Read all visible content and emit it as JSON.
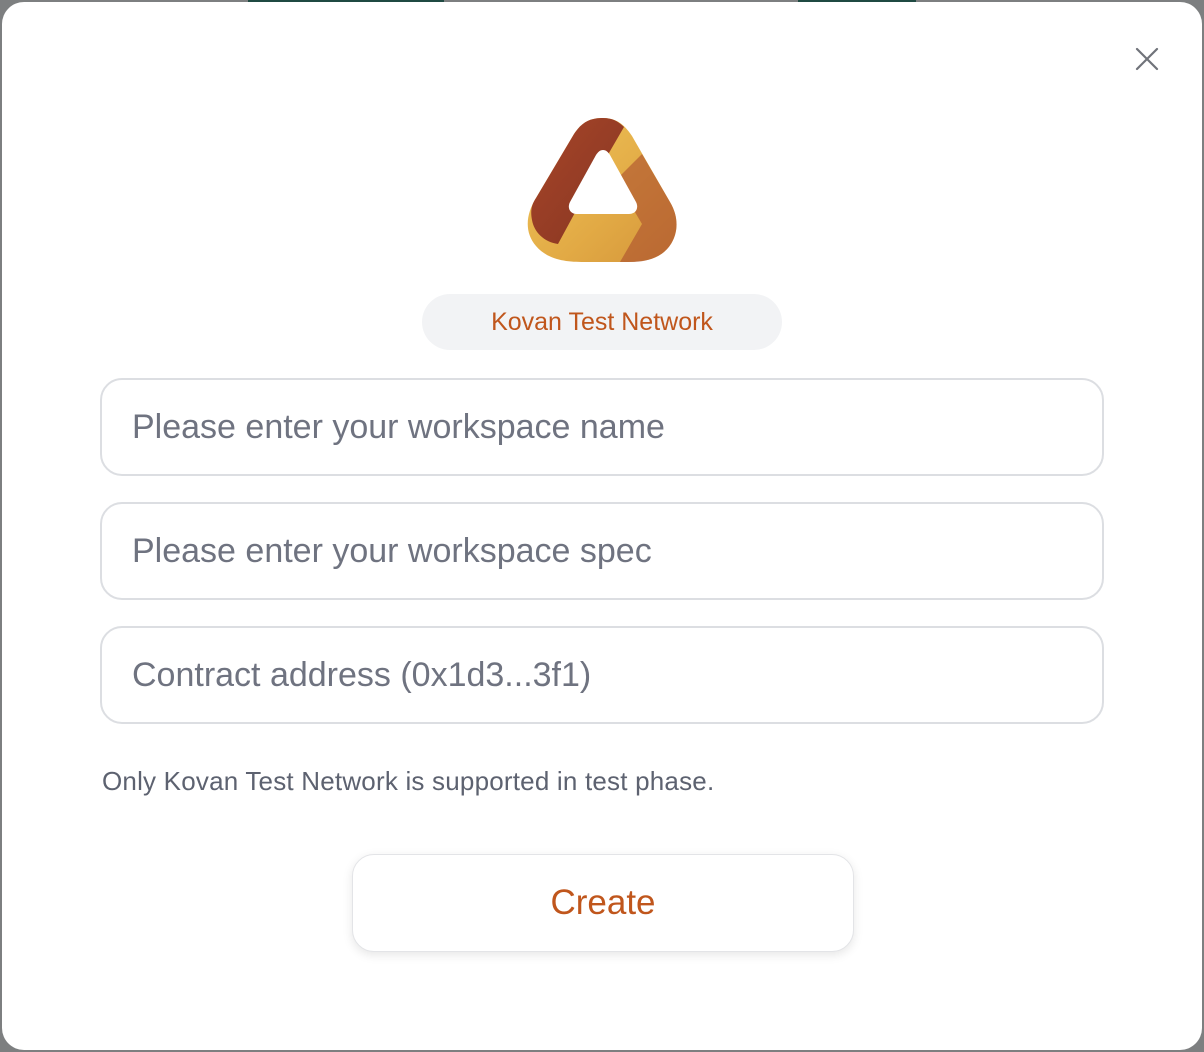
{
  "modal": {
    "logo_icon": "tri-loop-logo-icon",
    "close_icon": "close-icon",
    "network_label": "Kovan Test Network",
    "fields": [
      {
        "value": "",
        "placeholder": "Please enter your workspace name"
      },
      {
        "value": "",
        "placeholder": "Please enter your workspace spec"
      },
      {
        "value": "",
        "placeholder": "Contract address (0x1d3...3f1)"
      }
    ],
    "hint": "Only Kovan Test Network is supported in test phase.",
    "create_label": "Create"
  },
  "colors": {
    "accent": "#c0561c",
    "logo_gold": "#e6b34a",
    "logo_rust": "#8f3322",
    "pill_bg": "#f2f3f5"
  }
}
